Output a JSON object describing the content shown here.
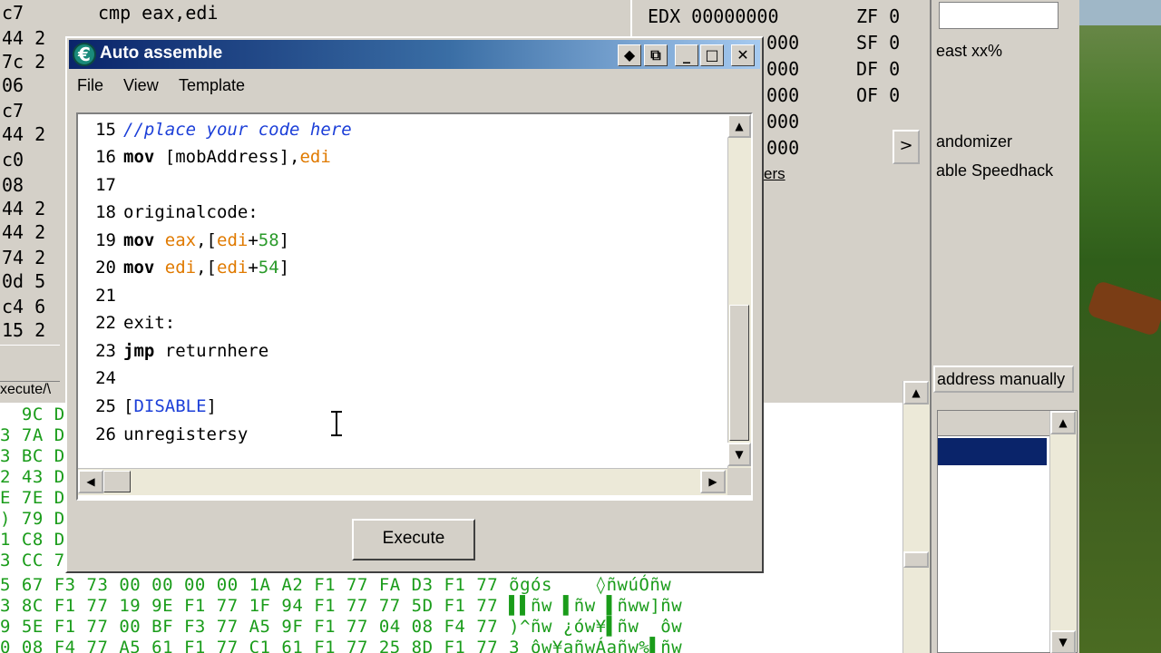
{
  "background": {
    "disasm_rows": [
      {
        "bytes": "c7",
        "instr": "cmp eax,edi"
      },
      {
        "bytes": "44 2",
        "instr": ""
      },
      {
        "bytes": "7c 2",
        "instr": ""
      },
      {
        "bytes": "06",
        "instr": ""
      },
      {
        "bytes": "c7",
        "instr": ""
      },
      {
        "bytes": "44 2",
        "instr": ""
      },
      {
        "bytes": "c0",
        "instr": ""
      },
      {
        "bytes": "08",
        "instr": ""
      },
      {
        "bytes": "44 2",
        "instr": ""
      },
      {
        "bytes": "44 2",
        "instr": ""
      },
      {
        "bytes": "74 2",
        "instr": ""
      },
      {
        "bytes": "0d 5",
        "instr": ""
      },
      {
        "bytes": "c4 6",
        "instr": ""
      },
      {
        "bytes": "15 2",
        "instr": ""
      }
    ],
    "hex_header": "xecute/\\",
    "hex_rows": [
      "  9C D:",
      "3 7A D:",
      "3 BC D:",
      "2 43 D:",
      "E 7E D:",
      ") 79 D:",
      "1 C8 D:",
      "3 CC 7",
      "5 67 F3 73 00 00 00 00 1A A2 F1 77 FA D3 F1 77 õgós    ◊ñwúÓñw",
      "3 8C F1 77 19 9E F1 77 1F 94 F1 77 77 5D F1 77 ▌▌ñw ▌ñw ▌ñww]ñw",
      "9 5E F1 77 00 BF F3 77 A5 9F F1 77 04 08 F4 77 )^ñw ¿ów¥▌ñw  ôw",
      "0 08 F4 77 A5 61 F1 77 C1 61 F1 77 25 8D F1 77 3 ôw¥añwÁañw%▌ñw"
    ],
    "registers": [
      {
        "name": "EDX",
        "value": "00000000"
      },
      {
        "name": "",
        "value": "000"
      },
      {
        "name": "",
        "value": "000"
      },
      {
        "name": "",
        "value": "000"
      },
      {
        "name": "",
        "value": "000"
      },
      {
        "name": "",
        "value": "000"
      }
    ],
    "flags": [
      {
        "name": "ZF",
        "value": "0"
      },
      {
        "name": "SF",
        "value": "0"
      },
      {
        "name": "DF",
        "value": "0"
      },
      {
        "name": "OF",
        "value": "0"
      }
    ],
    "registers_link": "ers",
    "reg_arrow": ">",
    "main_texts": {
      "least": "east xx%",
      "randomizer": "andomizer",
      "speedhack": "able Speedhack"
    },
    "add_address_button": "address manually"
  },
  "dialog": {
    "title": "Auto assemble",
    "menu": [
      "File",
      "View",
      "Template"
    ],
    "titlebar_buttons": {
      "pin": "◆",
      "restore_alt": "⧉",
      "minimize": "_",
      "maximize": "□",
      "close": "✕"
    },
    "lines": [
      {
        "num": "15"
      },
      {
        "num": "16"
      },
      {
        "num": "17"
      },
      {
        "num": "18"
      },
      {
        "num": "19"
      },
      {
        "num": "20"
      },
      {
        "num": "21"
      },
      {
        "num": "22"
      },
      {
        "num": "23"
      },
      {
        "num": "24"
      },
      {
        "num": "25"
      },
      {
        "num": "26"
      }
    ],
    "code": {
      "l15_comment": "//place your code here",
      "l16_kw": "mov",
      "l16_a": " [mobAddress],",
      "l16_reg": "edi",
      "l18_label": "originalcode:",
      "l19_kw": "mov",
      "l19_reg1": "eax",
      "l19_a": ",[",
      "l19_reg2": "edi",
      "l19_plus": "+",
      "l19_num": "58",
      "l19_close": "]",
      "l20_kw": "mov",
      "l20_reg1": "edi",
      "l20_a": ",[",
      "l20_reg2": "edi",
      "l20_plus": "+",
      "l20_num": "54",
      "l20_close": "]",
      "l22_label": "exit:",
      "l23_kw": "jmp",
      "l23_a": " returnhere",
      "l25_open": "[",
      "l25_word": "DISABLE",
      "l25_close": "]",
      "l26_text": "unregistersy"
    },
    "execute_button": "Execute",
    "scroll_up": "▲",
    "scroll_down": "▼",
    "scroll_left": "◀",
    "scroll_right": "▶"
  },
  "colors": {
    "keyword": "#000000",
    "register": "#e07a00",
    "number": "#2a9a2a",
    "comment": "#1c3fd8",
    "hex_text": "#1a9c1a",
    "title_gradient_start": "#0a246a"
  }
}
